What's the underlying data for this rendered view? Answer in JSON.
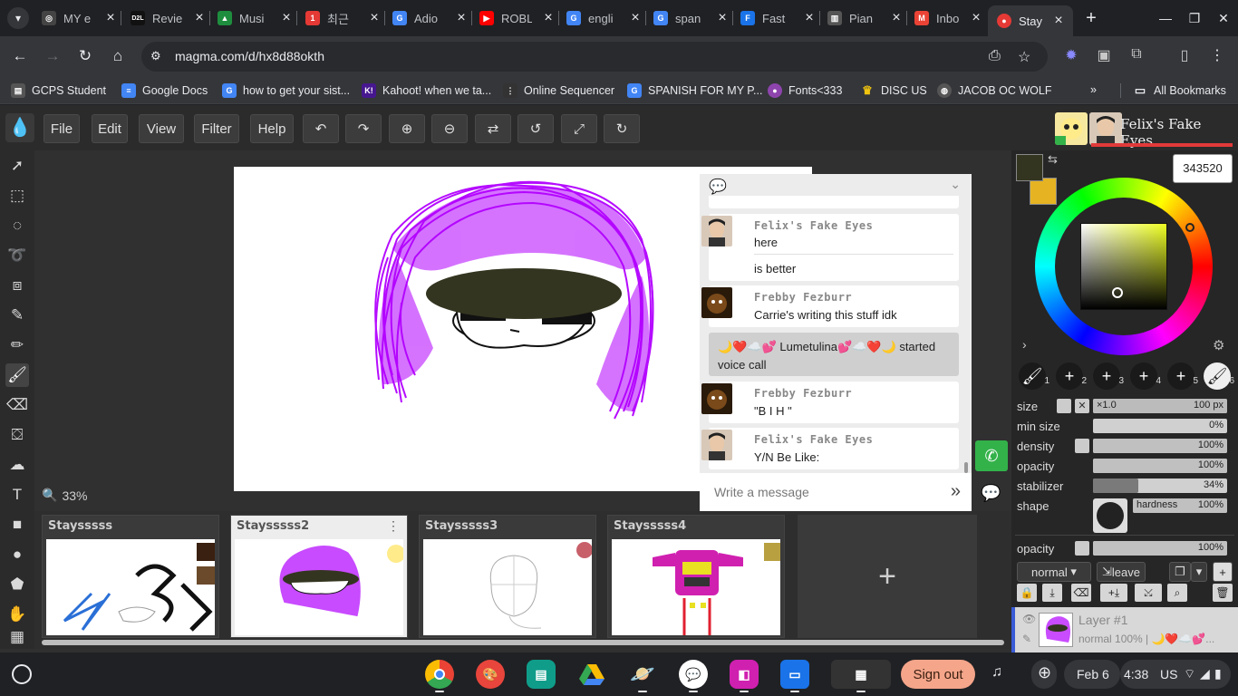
{
  "browser": {
    "tabs": [
      {
        "title": "MY e",
        "icon": "circle-icon",
        "color": "#444"
      },
      {
        "title": "Revie",
        "icon": "d2l-icon",
        "color": "#111"
      },
      {
        "title": "Musi",
        "icon": "drive-icon",
        "color": "#1e8e3e"
      },
      {
        "title": "최근",
        "icon": "app-icon",
        "color": "#e53935"
      },
      {
        "title": "Adio",
        "icon": "google-icon",
        "color": "#4285f4"
      },
      {
        "title": "ROBL",
        "icon": "youtube-icon",
        "color": "#ff0000"
      },
      {
        "title": "engli",
        "icon": "google-icon",
        "color": "#4285f4"
      },
      {
        "title": "span",
        "icon": "google-icon",
        "color": "#4285f4"
      },
      {
        "title": "Fast",
        "icon": "fast-icon",
        "color": "#1a73e8"
      },
      {
        "title": "Pian",
        "icon": "piano-icon",
        "color": "#555"
      },
      {
        "title": "Inbo",
        "icon": "gmail-icon",
        "color": "#ea4335"
      },
      {
        "title": "Stay",
        "icon": "magma-icon",
        "color": "#e53935",
        "active": true
      }
    ],
    "url": "magma.com/d/hx8d88okth",
    "bookmarks": [
      {
        "label": "GCPS Student",
        "color": "#555"
      },
      {
        "label": "Google Docs",
        "color": "#4285f4"
      },
      {
        "label": "how to get your sist...",
        "color": "#4285f4"
      },
      {
        "label": "Kahoot! when we ta...",
        "color": "#46178f"
      },
      {
        "label": "Online Sequencer",
        "color": "#333"
      },
      {
        "label": "SPANISH FOR MY P...",
        "color": "#4285f4"
      },
      {
        "label": "Fonts<333",
        "color": "#8e44ad"
      },
      {
        "label": "DISC US",
        "color": "#f1c40f"
      },
      {
        "label": "JACOB OC WOLF",
        "color": "#555"
      }
    ],
    "all_bookmarks": "All Bookmarks"
  },
  "app": {
    "menu": [
      "File",
      "Edit",
      "View",
      "Filter",
      "Help"
    ],
    "user_name": "Felix's Fake Eyes",
    "zoom": "33%",
    "chat": {
      "messages": [
        {
          "type": "user",
          "name": "Felix's Fake Eyes",
          "lines": [
            "here",
            "is better"
          ]
        },
        {
          "type": "user",
          "name": "Frebby Fezburr",
          "lines": [
            "Carrie's writing this stuff idk"
          ]
        },
        {
          "type": "system",
          "text": "🌙❤️☁️💕 Lumetulina💕☁️❤️🌙 started voice call"
        },
        {
          "type": "user",
          "name": "Frebby Fezburr",
          "lines": [
            "\"B I H \""
          ]
        },
        {
          "type": "user",
          "name": "Felix's Fake Eyes",
          "lines": [
            "Y/N Be Like:"
          ]
        }
      ],
      "placeholder": "Write a message"
    },
    "documents": [
      {
        "name": "Staysssss"
      },
      {
        "name": "Staysssss2",
        "selected": true
      },
      {
        "name": "Staysssss3"
      },
      {
        "name": "Staysssss4"
      }
    ],
    "new_doc": "+",
    "color": {
      "primary": "#343520",
      "secondary": "#e6b422",
      "hex": "343520"
    },
    "brush_slots": [
      "1",
      "2",
      "3",
      "4",
      "5",
      "6"
    ],
    "brush": {
      "size_label": "size",
      "size_mult": "×1.0",
      "size_value": "100 px",
      "min_size_label": "min size",
      "min_size_value": "0%",
      "min_size_level": 0,
      "density_label": "density",
      "density_value": "100%",
      "density_level": 1,
      "opacity_label": "opacity",
      "opacity_value": "100%",
      "opacity_level": 1,
      "stabilizer_label": "stabilizer",
      "stabilizer_value": "34%",
      "stabilizer_level": 0.34,
      "shape_label": "shape",
      "hardness_label": "hardness",
      "hardness_value": "100%"
    },
    "layer_opacity_label": "opacity",
    "layer_opacity_value": "100%",
    "blend_mode": "normal",
    "leave_label": "leave",
    "layer": {
      "name": "Layer #1",
      "meta": "normal 100% | 🌙❤️☁️💕..."
    }
  },
  "shelf": {
    "sign_out": "Sign out",
    "date": "Feb 6",
    "time": "4:38",
    "locale": "US"
  }
}
